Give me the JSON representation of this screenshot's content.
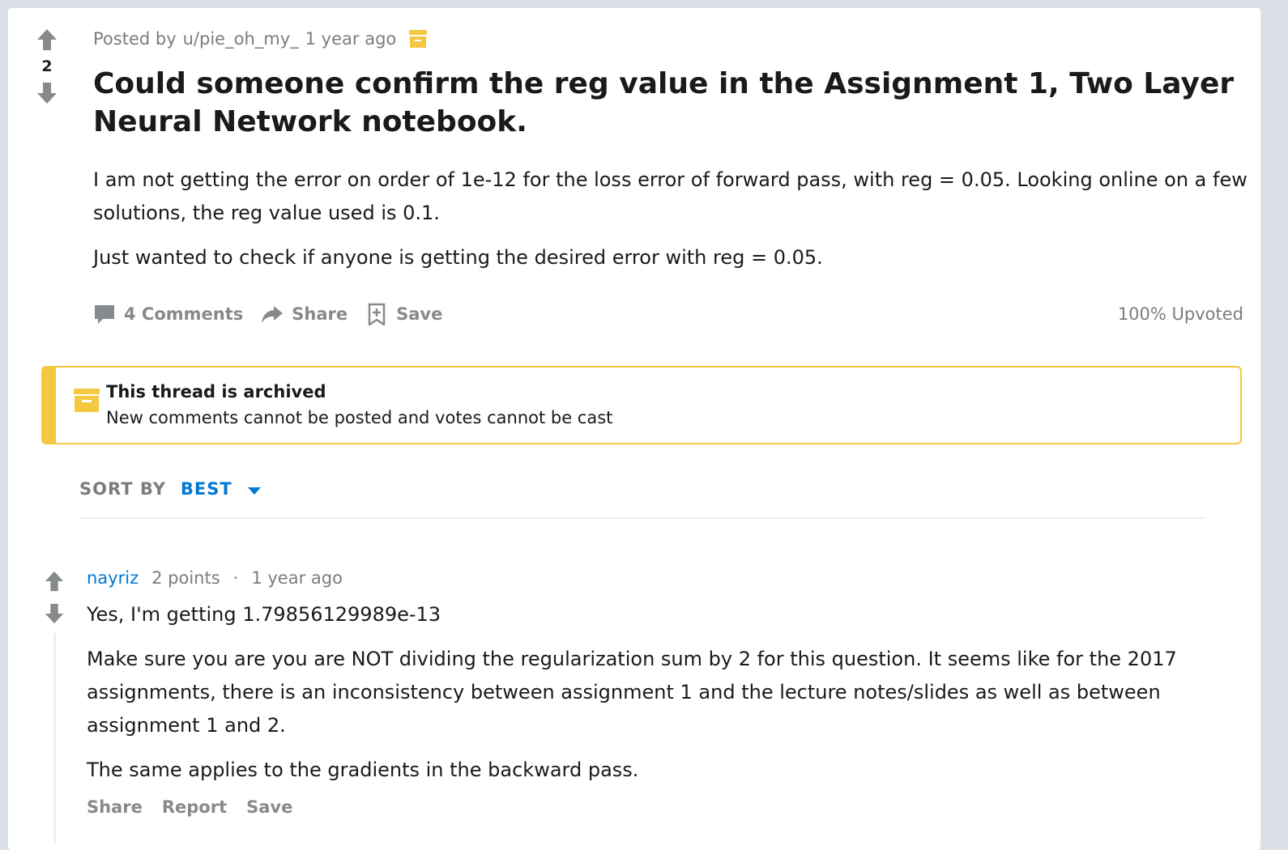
{
  "post": {
    "score": "2",
    "meta_prefix": "Posted by",
    "author": "u/pie_oh_my_",
    "time": "1 year ago",
    "title": "Could someone confirm the reg value in the Assignment 1, Two Layer Neural Network notebook.",
    "body": [
      "I am not getting the error on order of 1e-12 for the loss error of forward pass, with reg = 0.05. Looking online on a few solutions, the reg value used is 0.1.",
      "Just wanted to check if anyone is getting the desired error with reg = 0.05."
    ],
    "actions": {
      "comments": "4 Comments",
      "share": "Share",
      "save": "Save"
    },
    "upvoted": "100% Upvoted"
  },
  "archived": {
    "title": "This thread is archived",
    "description": "New comments cannot be posted and votes cannot be cast"
  },
  "sort": {
    "label": "SORT BY",
    "value": "BEST"
  },
  "comment": {
    "author": "nayriz",
    "points": "2 points",
    "separator": "·",
    "time": "1 year ago",
    "body": [
      "Yes, I'm getting 1.79856129989e-13",
      "Make sure you are you are NOT dividing the regularization sum by 2 for this question. It seems like for the 2017 assignments, there is an inconsistency between assignment 1 and the lecture notes/slides as well as between assignment 1 and 2.",
      "The same applies to the gradients in the backward pass."
    ],
    "actions": {
      "share": "Share",
      "report": "Report",
      "save": "Save"
    }
  },
  "colors": {
    "accent": "#0079d3",
    "archive_yellow": "#f5c842",
    "muted": "#878a8c"
  }
}
